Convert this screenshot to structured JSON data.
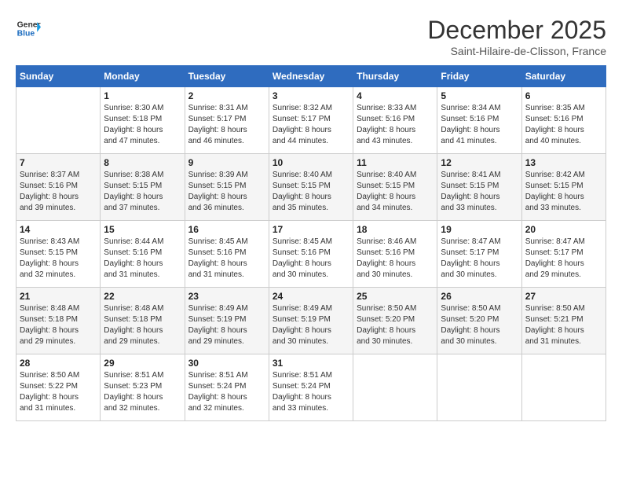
{
  "header": {
    "logo_line1": "General",
    "logo_line2": "Blue",
    "month_year": "December 2025",
    "location": "Saint-Hilaire-de-Clisson, France"
  },
  "weekdays": [
    "Sunday",
    "Monday",
    "Tuesday",
    "Wednesday",
    "Thursday",
    "Friday",
    "Saturday"
  ],
  "weeks": [
    [
      {
        "day": "",
        "info": ""
      },
      {
        "day": "1",
        "info": "Sunrise: 8:30 AM\nSunset: 5:18 PM\nDaylight: 8 hours\nand 47 minutes."
      },
      {
        "day": "2",
        "info": "Sunrise: 8:31 AM\nSunset: 5:17 PM\nDaylight: 8 hours\nand 46 minutes."
      },
      {
        "day": "3",
        "info": "Sunrise: 8:32 AM\nSunset: 5:17 PM\nDaylight: 8 hours\nand 44 minutes."
      },
      {
        "day": "4",
        "info": "Sunrise: 8:33 AM\nSunset: 5:16 PM\nDaylight: 8 hours\nand 43 minutes."
      },
      {
        "day": "5",
        "info": "Sunrise: 8:34 AM\nSunset: 5:16 PM\nDaylight: 8 hours\nand 41 minutes."
      },
      {
        "day": "6",
        "info": "Sunrise: 8:35 AM\nSunset: 5:16 PM\nDaylight: 8 hours\nand 40 minutes."
      }
    ],
    [
      {
        "day": "7",
        "info": "Sunrise: 8:37 AM\nSunset: 5:16 PM\nDaylight: 8 hours\nand 39 minutes."
      },
      {
        "day": "8",
        "info": "Sunrise: 8:38 AM\nSunset: 5:15 PM\nDaylight: 8 hours\nand 37 minutes."
      },
      {
        "day": "9",
        "info": "Sunrise: 8:39 AM\nSunset: 5:15 PM\nDaylight: 8 hours\nand 36 minutes."
      },
      {
        "day": "10",
        "info": "Sunrise: 8:40 AM\nSunset: 5:15 PM\nDaylight: 8 hours\nand 35 minutes."
      },
      {
        "day": "11",
        "info": "Sunrise: 8:40 AM\nSunset: 5:15 PM\nDaylight: 8 hours\nand 34 minutes."
      },
      {
        "day": "12",
        "info": "Sunrise: 8:41 AM\nSunset: 5:15 PM\nDaylight: 8 hours\nand 33 minutes."
      },
      {
        "day": "13",
        "info": "Sunrise: 8:42 AM\nSunset: 5:15 PM\nDaylight: 8 hours\nand 33 minutes."
      }
    ],
    [
      {
        "day": "14",
        "info": "Sunrise: 8:43 AM\nSunset: 5:15 PM\nDaylight: 8 hours\nand 32 minutes."
      },
      {
        "day": "15",
        "info": "Sunrise: 8:44 AM\nSunset: 5:16 PM\nDaylight: 8 hours\nand 31 minutes."
      },
      {
        "day": "16",
        "info": "Sunrise: 8:45 AM\nSunset: 5:16 PM\nDaylight: 8 hours\nand 31 minutes."
      },
      {
        "day": "17",
        "info": "Sunrise: 8:45 AM\nSunset: 5:16 PM\nDaylight: 8 hours\nand 30 minutes."
      },
      {
        "day": "18",
        "info": "Sunrise: 8:46 AM\nSunset: 5:16 PM\nDaylight: 8 hours\nand 30 minutes."
      },
      {
        "day": "19",
        "info": "Sunrise: 8:47 AM\nSunset: 5:17 PM\nDaylight: 8 hours\nand 30 minutes."
      },
      {
        "day": "20",
        "info": "Sunrise: 8:47 AM\nSunset: 5:17 PM\nDaylight: 8 hours\nand 29 minutes."
      }
    ],
    [
      {
        "day": "21",
        "info": "Sunrise: 8:48 AM\nSunset: 5:18 PM\nDaylight: 8 hours\nand 29 minutes."
      },
      {
        "day": "22",
        "info": "Sunrise: 8:48 AM\nSunset: 5:18 PM\nDaylight: 8 hours\nand 29 minutes."
      },
      {
        "day": "23",
        "info": "Sunrise: 8:49 AM\nSunset: 5:19 PM\nDaylight: 8 hours\nand 29 minutes."
      },
      {
        "day": "24",
        "info": "Sunrise: 8:49 AM\nSunset: 5:19 PM\nDaylight: 8 hours\nand 30 minutes."
      },
      {
        "day": "25",
        "info": "Sunrise: 8:50 AM\nSunset: 5:20 PM\nDaylight: 8 hours\nand 30 minutes."
      },
      {
        "day": "26",
        "info": "Sunrise: 8:50 AM\nSunset: 5:20 PM\nDaylight: 8 hours\nand 30 minutes."
      },
      {
        "day": "27",
        "info": "Sunrise: 8:50 AM\nSunset: 5:21 PM\nDaylight: 8 hours\nand 31 minutes."
      }
    ],
    [
      {
        "day": "28",
        "info": "Sunrise: 8:50 AM\nSunset: 5:22 PM\nDaylight: 8 hours\nand 31 minutes."
      },
      {
        "day": "29",
        "info": "Sunrise: 8:51 AM\nSunset: 5:23 PM\nDaylight: 8 hours\nand 32 minutes."
      },
      {
        "day": "30",
        "info": "Sunrise: 8:51 AM\nSunset: 5:24 PM\nDaylight: 8 hours\nand 32 minutes."
      },
      {
        "day": "31",
        "info": "Sunrise: 8:51 AM\nSunset: 5:24 PM\nDaylight: 8 hours\nand 33 minutes."
      },
      {
        "day": "",
        "info": ""
      },
      {
        "day": "",
        "info": ""
      },
      {
        "day": "",
        "info": ""
      }
    ]
  ]
}
